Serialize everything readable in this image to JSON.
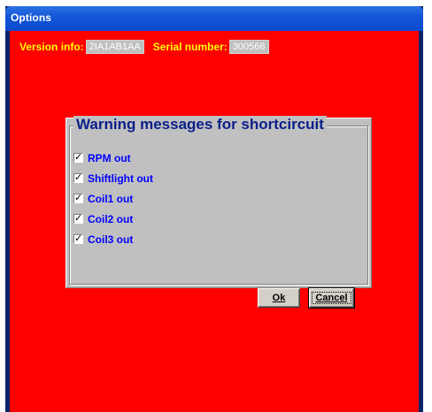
{
  "window": {
    "title": "Options"
  },
  "info": {
    "version_label": "Version info:",
    "version_value": "2IA1AB1AA",
    "serial_label": "Serial number:",
    "serial_value": "300566"
  },
  "group": {
    "title": "Warning messages for shortcircuit",
    "items": [
      {
        "label": "RPM out",
        "checked": true
      },
      {
        "label": "Shiftlight out",
        "checked": true
      },
      {
        "label": "Coil1 out",
        "checked": true
      },
      {
        "label": "Coil2 out",
        "checked": true
      },
      {
        "label": "Coil3 out",
        "checked": true
      }
    ]
  },
  "buttons": {
    "ok_label": "Ok",
    "cancel_label": "Cancel"
  },
  "colors": {
    "background": "#ff0000",
    "label_text": "#ffff00",
    "group_title": "#0a1f8a",
    "check_label": "#0000ff",
    "panel": "#c0c0c0"
  }
}
